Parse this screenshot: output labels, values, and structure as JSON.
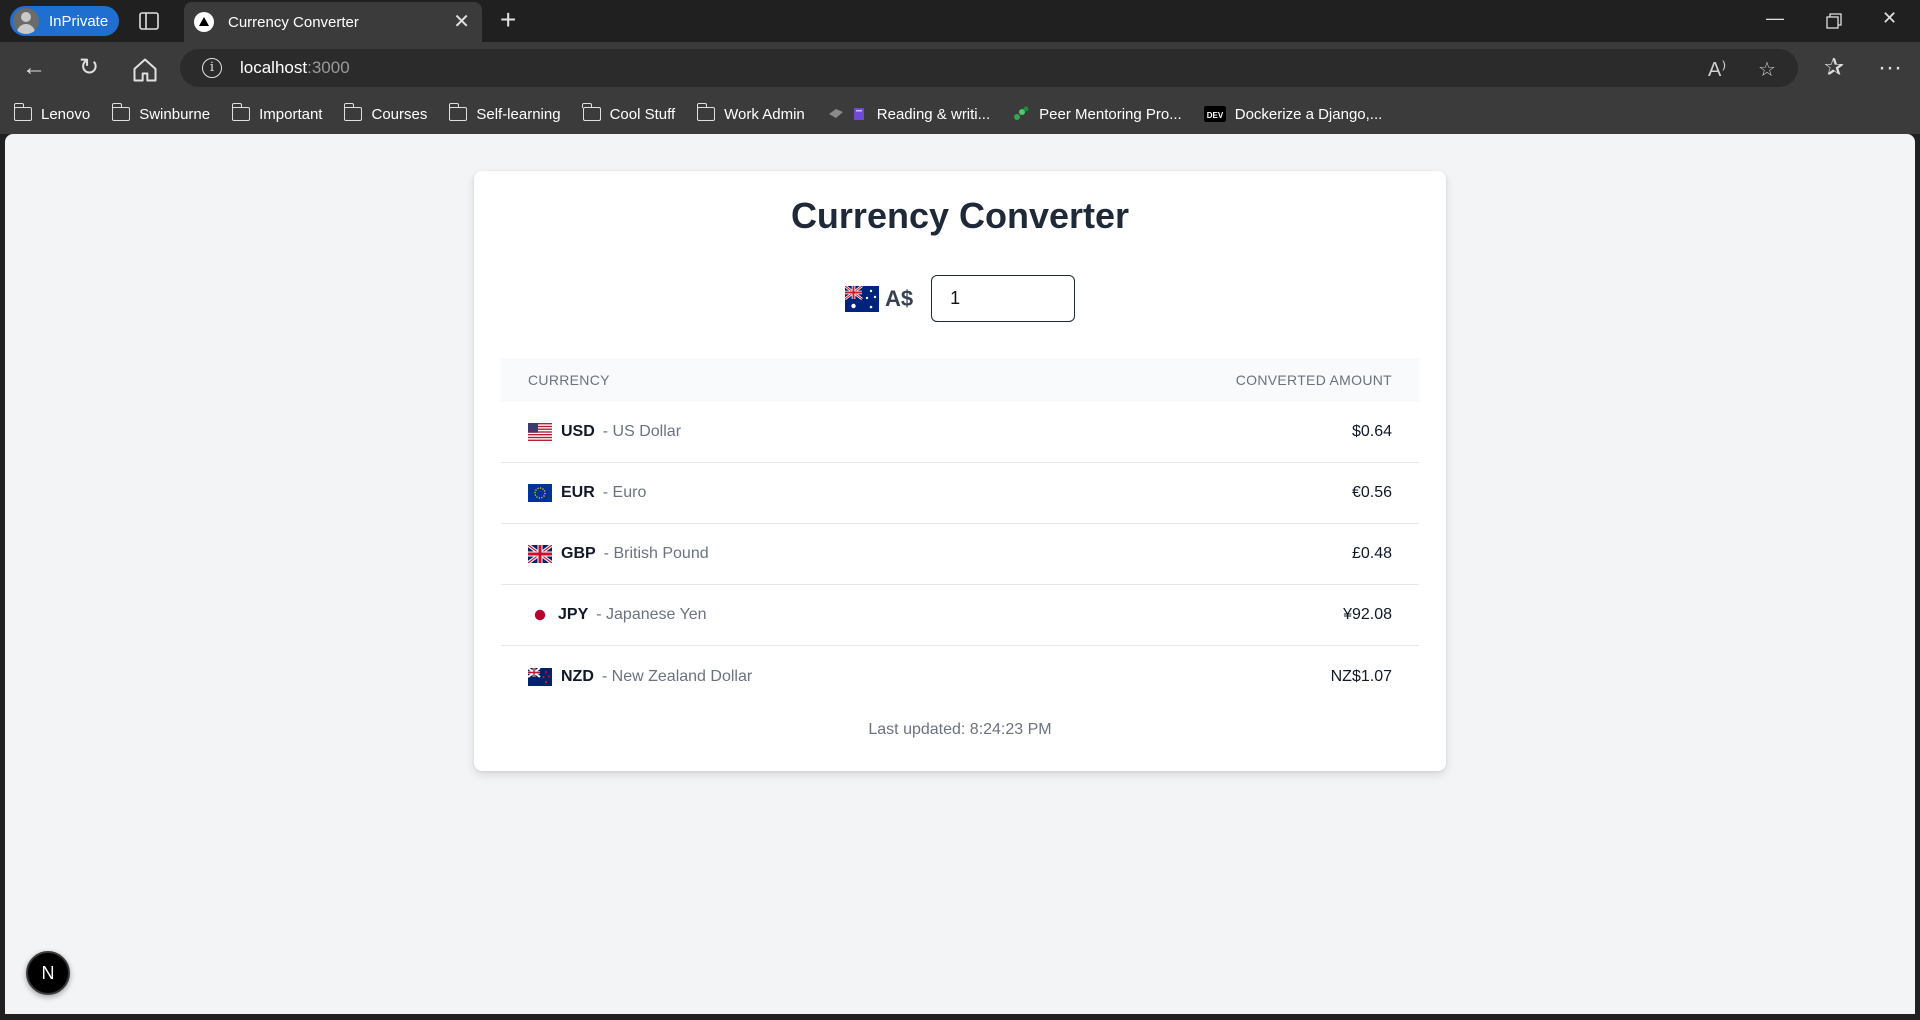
{
  "browser": {
    "profile_label": "InPrivate",
    "tab_title": "Currency Converter",
    "url_host": "localhost",
    "url_port": ":3000",
    "bookmarks": [
      {
        "label": "Lenovo",
        "icon": "folder-icon"
      },
      {
        "label": "Swinburne",
        "icon": "folder-icon"
      },
      {
        "label": "Important",
        "icon": "folder-icon"
      },
      {
        "label": "Courses",
        "icon": "folder-icon"
      },
      {
        "label": "Self-learning",
        "icon": "folder-icon"
      },
      {
        "label": "Cool Stuff",
        "icon": "folder-icon"
      },
      {
        "label": "Work Admin",
        "icon": "folder-icon"
      },
      {
        "label": "Reading & writi...",
        "icon": "reading-site-icon"
      },
      {
        "label": "Peer Mentoring Pro...",
        "icon": "peer-mentoring-icon"
      },
      {
        "label": "Dockerize a Django,...",
        "icon": "dev-to-icon"
      }
    ]
  },
  "page": {
    "title": "Currency Converter",
    "base_symbol": "A$",
    "amount_value": "1",
    "table_headers": {
      "currency": "CURRENCY",
      "converted": "CONVERTED AMOUNT"
    },
    "rows": [
      {
        "code": "USD",
        "name": "- US Dollar",
        "amount": "$0.64",
        "flag": "us-flag-icon"
      },
      {
        "code": "EUR",
        "name": "- Euro",
        "amount": "€0.56",
        "flag": "eu-flag-icon"
      },
      {
        "code": "GBP",
        "name": "- British Pound",
        "amount": "£0.48",
        "flag": "uk-flag-icon"
      },
      {
        "code": "JPY",
        "name": "- Japanese Yen",
        "amount": "¥92.08",
        "flag": "japan-flag-icon"
      },
      {
        "code": "NZD",
        "name": "- New Zealand Dollar",
        "amount": "NZ$1.07",
        "flag": "nz-flag-icon"
      }
    ],
    "last_updated": "Last updated: 8:24:23 PM",
    "dev_badge": "N"
  }
}
